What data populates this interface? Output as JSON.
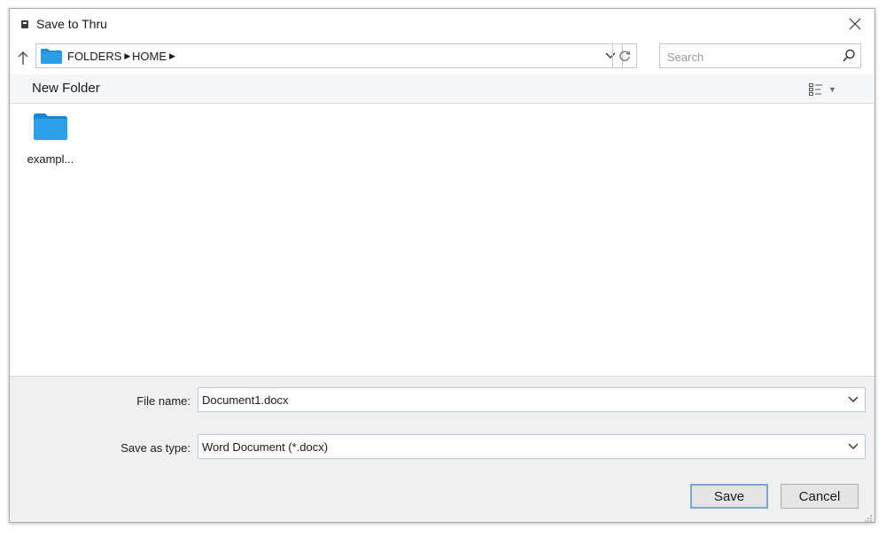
{
  "window": {
    "title": "Save to Thru"
  },
  "address_bar": {
    "crumbs": [
      "FOLDERS",
      "HOME"
    ]
  },
  "search": {
    "placeholder": "Search"
  },
  "toolbar": {
    "new_folder_label": "New Folder"
  },
  "files": [
    {
      "name": "exampl...",
      "icon": "folder-icon"
    }
  ],
  "form": {
    "file_name_label": "File name:",
    "file_name_value": "Document1.docx",
    "save_as_type_label": "Save as type:",
    "save_as_type_value": "Word Document (*.docx)"
  },
  "buttons": {
    "save_label": "Save",
    "cancel_label": "Cancel"
  },
  "colors": {
    "folder": "#1e8fde",
    "primary_button_border": "#7aa7d9",
    "field_border": "#b6c9e3"
  }
}
